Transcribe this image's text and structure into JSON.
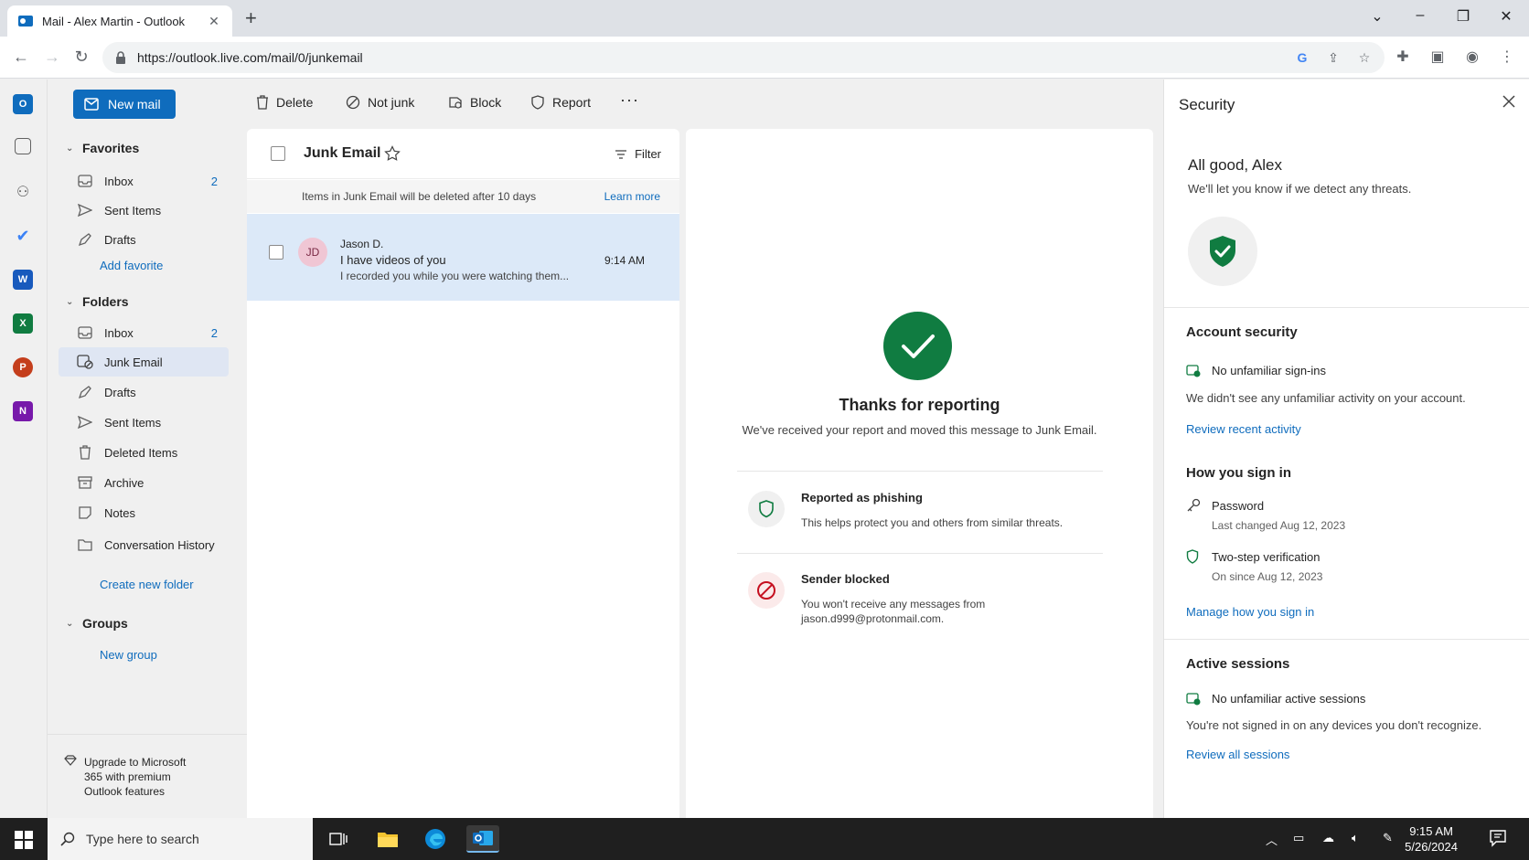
{
  "browser": {
    "tab_title": "Mail - Alex Martin - Outlook",
    "url": "https://outlook.live.com/mail/0/junkemail"
  },
  "toolbar": {
    "new_mail": "New mail",
    "delete": "Delete",
    "not_junk": "Not junk",
    "block": "Block",
    "report": "Report",
    "more": "···"
  },
  "folders": {
    "favorites_label": "Favorites",
    "favorites": [
      {
        "label": "Inbox",
        "count": "2"
      },
      {
        "label": "Sent Items",
        "count": ""
      },
      {
        "label": "Drafts",
        "count": ""
      }
    ],
    "add_favorite": "Add favorite",
    "folders_label": "Folders",
    "items": [
      {
        "label": "Inbox",
        "count": "2"
      },
      {
        "label": "Junk Email",
        "count": ""
      },
      {
        "label": "Drafts",
        "count": ""
      },
      {
        "label": "Sent Items",
        "count": ""
      },
      {
        "label": "Deleted Items",
        "count": ""
      },
      {
        "label": "Archive",
        "count": ""
      },
      {
        "label": "Notes",
        "count": ""
      },
      {
        "label": "Conversation History",
        "count": ""
      }
    ],
    "create_folder": "Create new folder",
    "groups_label": "Groups",
    "new_group": "New group",
    "upgrade": "Upgrade to Microsoft 365 with premium Outlook features"
  },
  "message_list": {
    "title": "Junk Email",
    "filter": "Filter",
    "notice": "Items in Junk Email will be deleted after 10 days",
    "learn_more": "Learn more",
    "messages": [
      {
        "initials": "JD",
        "from": "Jason D.",
        "subject": "I have videos of you",
        "preview": "I recorded you while you were watching them...",
        "time": "9:14 AM"
      }
    ]
  },
  "reading_pane": {
    "title": "Thanks for reporting",
    "subtitle": "We've received your report and moved this message to Junk Email.",
    "items": [
      {
        "heading": "Reported as phishing",
        "detail": "This helps protect you and others from similar threats."
      },
      {
        "heading": "Sender blocked",
        "detail": "You won't receive any messages from jason.d999@protonmail.com."
      }
    ]
  },
  "security": {
    "title": "Security",
    "greeting": "All good, Alex",
    "greeting_sub": "We'll let you know if we detect any threats.",
    "account_security": {
      "heading": "Account security",
      "status": "No unfamiliar sign-ins",
      "note": "We didn't see any unfamiliar activity on your account.",
      "link": "Review recent activity"
    },
    "sign_in": {
      "heading": "How you sign in",
      "password": "Password",
      "password_sub": "Last changed Aug 12, 2023",
      "two_step": "Two-step verification",
      "two_step_sub": "On since Aug 12, 2023",
      "link": "Manage how you sign in"
    },
    "sessions": {
      "heading": "Active sessions",
      "status": "No unfamiliar active sessions",
      "note": "You're not signed in on any devices you don't recognize.",
      "link": "Review all sessions"
    }
  },
  "taskbar": {
    "search_placeholder": "Type here to search",
    "time": "9:15 AM",
    "date": "5/26/2024"
  },
  "colors": {
    "accent": "#0f6cbd",
    "success": "#107c41",
    "danger": "#c50f1f"
  }
}
